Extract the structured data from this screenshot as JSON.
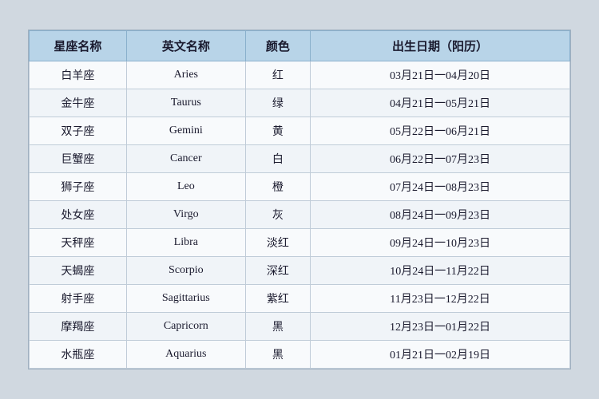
{
  "table": {
    "headers": {
      "chinese_name": "星座名称",
      "english_name": "英文名称",
      "color": "颜色",
      "birth_date": "出生日期（阳历）"
    },
    "rows": [
      {
        "chinese": "白羊座",
        "english": "Aries",
        "color": "红",
        "date": "03月21日一04月20日"
      },
      {
        "chinese": "金牛座",
        "english": "Taurus",
        "color": "绿",
        "date": "04月21日一05月21日"
      },
      {
        "chinese": "双子座",
        "english": "Gemini",
        "color": "黄",
        "date": "05月22日一06月21日"
      },
      {
        "chinese": "巨蟹座",
        "english": "Cancer",
        "color": "白",
        "date": "06月22日一07月23日"
      },
      {
        "chinese": "狮子座",
        "english": "Leo",
        "color": "橙",
        "date": "07月24日一08月23日"
      },
      {
        "chinese": "处女座",
        "english": "Virgo",
        "color": "灰",
        "date": "08月24日一09月23日"
      },
      {
        "chinese": "天秤座",
        "english": "Libra",
        "color": "淡红",
        "date": "09月24日一10月23日"
      },
      {
        "chinese": "天蝎座",
        "english": "Scorpio",
        "color": "深红",
        "date": "10月24日一11月22日"
      },
      {
        "chinese": "射手座",
        "english": "Sagittarius",
        "color": "紫红",
        "date": "11月23日一12月22日"
      },
      {
        "chinese": "摩羯座",
        "english": "Capricorn",
        "color": "黑",
        "date": "12月23日一01月22日"
      },
      {
        "chinese": "水瓶座",
        "english": "Aquarius",
        "color": "黑",
        "date": "01月21日一02月19日"
      }
    ]
  }
}
